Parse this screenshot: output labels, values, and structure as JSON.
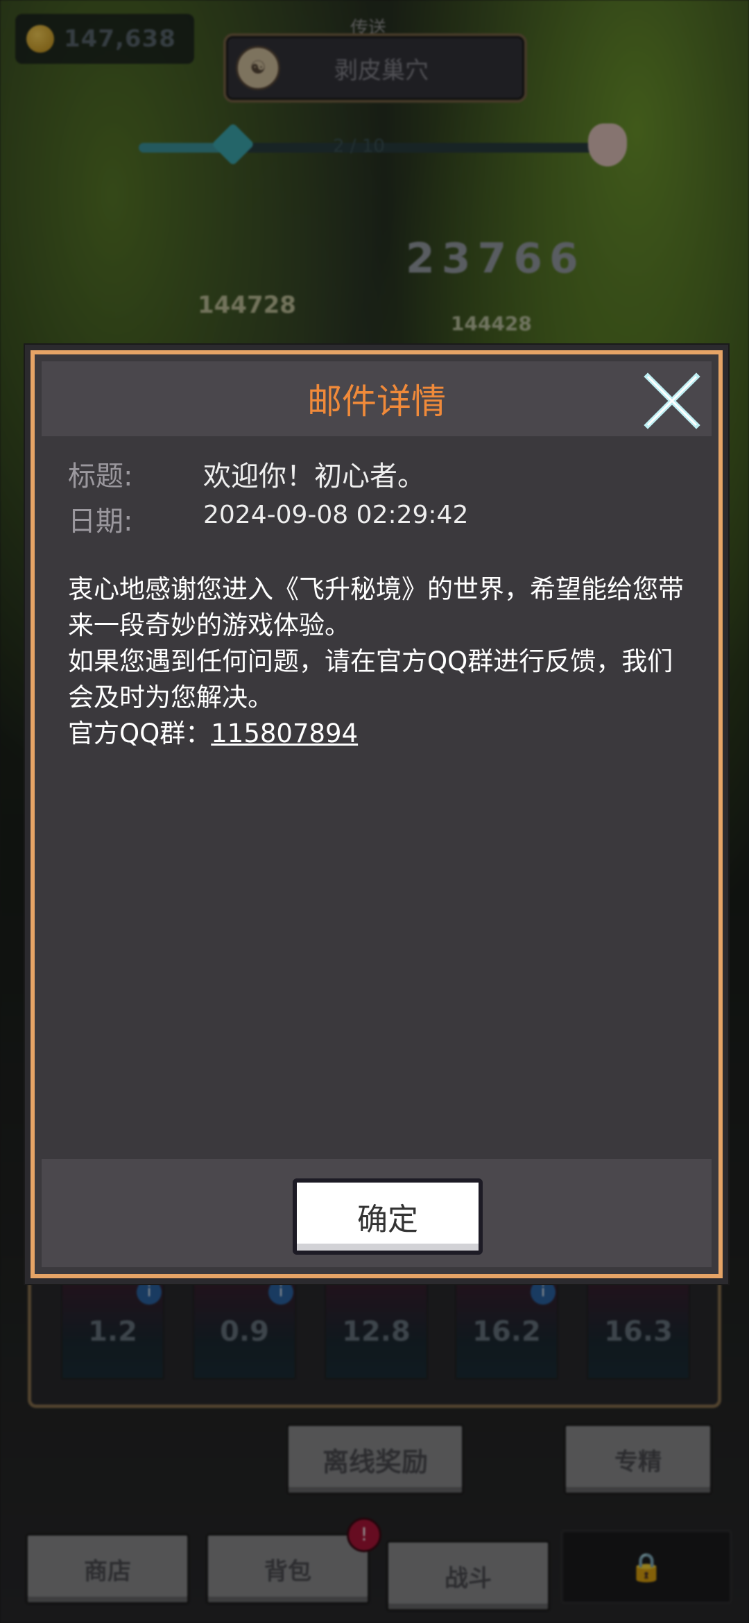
{
  "hud": {
    "gold": "147,638",
    "location_small": "传送",
    "location_name": "剥皮巢穴",
    "progress_text": "2 / 10",
    "progress_fraction": 0.2,
    "power": "23766",
    "damage_1": "144728",
    "damage_2": "144428"
  },
  "skills": [
    {
      "value": "1.2",
      "badge": "i"
    },
    {
      "value": "0.9",
      "badge": "i"
    },
    {
      "value": "12.8",
      "badge": ""
    },
    {
      "value": "16.2",
      "badge": "i"
    },
    {
      "value": "16.3",
      "badge": ""
    }
  ],
  "buttons": {
    "offline_reward": "离线奖励",
    "special": "专精",
    "shop": "商店",
    "bag": "背包",
    "bag_badge": "!",
    "battle": "战斗"
  },
  "dialog": {
    "title": "邮件详情",
    "subject_label": "标题:",
    "subject_value": "欢迎你！初心者。",
    "date_label": "日期:",
    "date_value": "2024-09-08  02:29:42",
    "body_line1": "衷心地感谢您进入《飞升秘境》的世界，希望能给您带来一段奇妙的游戏体验。",
    "body_line2": "如果您遇到任何问题，请在官方QQ群进行反馈，我们会及时为您解决。",
    "qq_label": "官方QQ群：",
    "qq_number": "115807894",
    "confirm_label": "确定"
  },
  "colors": {
    "dialog_border": "#e6a466",
    "title": "#f08a3a",
    "close_icon": "#bfeff3"
  }
}
